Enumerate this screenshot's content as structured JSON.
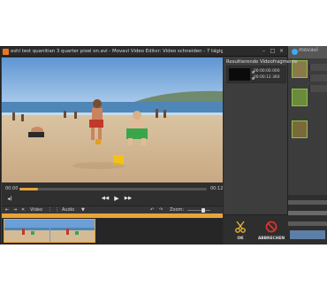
{
  "window": {
    "title": "eshl test quanitian 3 quarter pixel on.avi - Movavi Video Editor: Video schneiden - 7 tägige Demoversion",
    "controls": [
      "–",
      "□",
      "×"
    ]
  },
  "player": {
    "current_time": "00:00",
    "end_time": "00:12",
    "progress": 0.1,
    "buttons": {
      "prev": "◀◀",
      "play": "▶",
      "next": "▶▶"
    },
    "volume_icon": "speaker-icon"
  },
  "toolbar": {
    "items": [
      "⇤",
      "⇥",
      "✕",
      "Video",
      "⋮",
      "⋮",
      "Audio",
      "▼",
      "↶",
      "↷"
    ],
    "zoom_label": "Zoom:",
    "zoom_level": 0.7
  },
  "fragments": {
    "heading": "Resultierende Videofragmente",
    "items": [
      {
        "start": "00:00:00.000",
        "end": "00:00:12.360"
      }
    ]
  },
  "actions": {
    "ok_label": "OK",
    "cancel_label": "ABBRECHEN"
  },
  "background_app": {
    "brand": "movavi"
  },
  "colors": {
    "accent": "#e8a33a",
    "ok_icon": "#e6b030",
    "cancel_icon": "#d9342b",
    "window_bg": "#3d3d3d"
  }
}
